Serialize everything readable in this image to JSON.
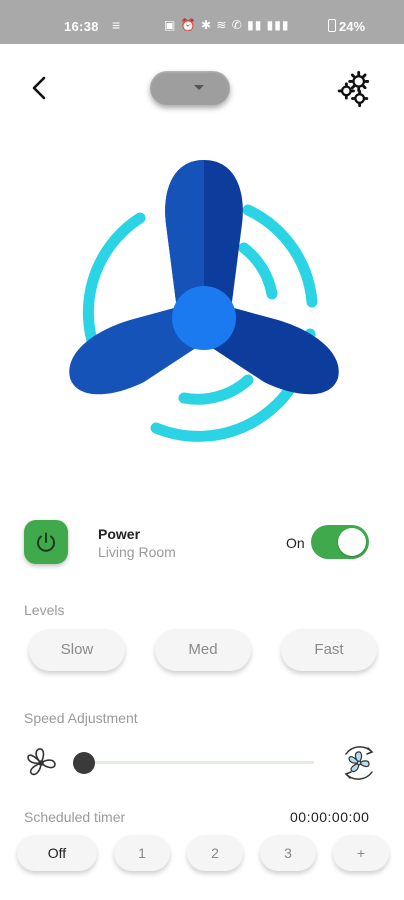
{
  "status_bar": {
    "time": "16:38",
    "eq_glyph": "≡",
    "icons_text": "▣ ⏰ ✱ ≋ ✆ ▮▮ ▮▮▮",
    "battery": "24%"
  },
  "header": {
    "back_icon": "chevron-left-icon",
    "device_select_value": "",
    "settings_icon": "gears-icon"
  },
  "fan_image": {
    "icon": "fan-icon",
    "colors": {
      "blade_dark": "#0d3d9c",
      "blade_light": "#1553b8",
      "hub": "#1c7af0",
      "rings": "#2ad4e4"
    }
  },
  "power": {
    "title": "Power",
    "room": "Living Room",
    "state_label": "On",
    "is_on": true,
    "color": "#3fa94c"
  },
  "levels": {
    "label": "Levels",
    "options": [
      "Slow",
      "Med",
      "Fast"
    ]
  },
  "speed": {
    "label": "Speed Adjustment",
    "value_fraction": 0.0
  },
  "timer": {
    "label": "Scheduled timer",
    "value": "00:00:00:00",
    "options": [
      "Off",
      "1",
      "2",
      "3",
      "+"
    ],
    "selected": "Off"
  }
}
